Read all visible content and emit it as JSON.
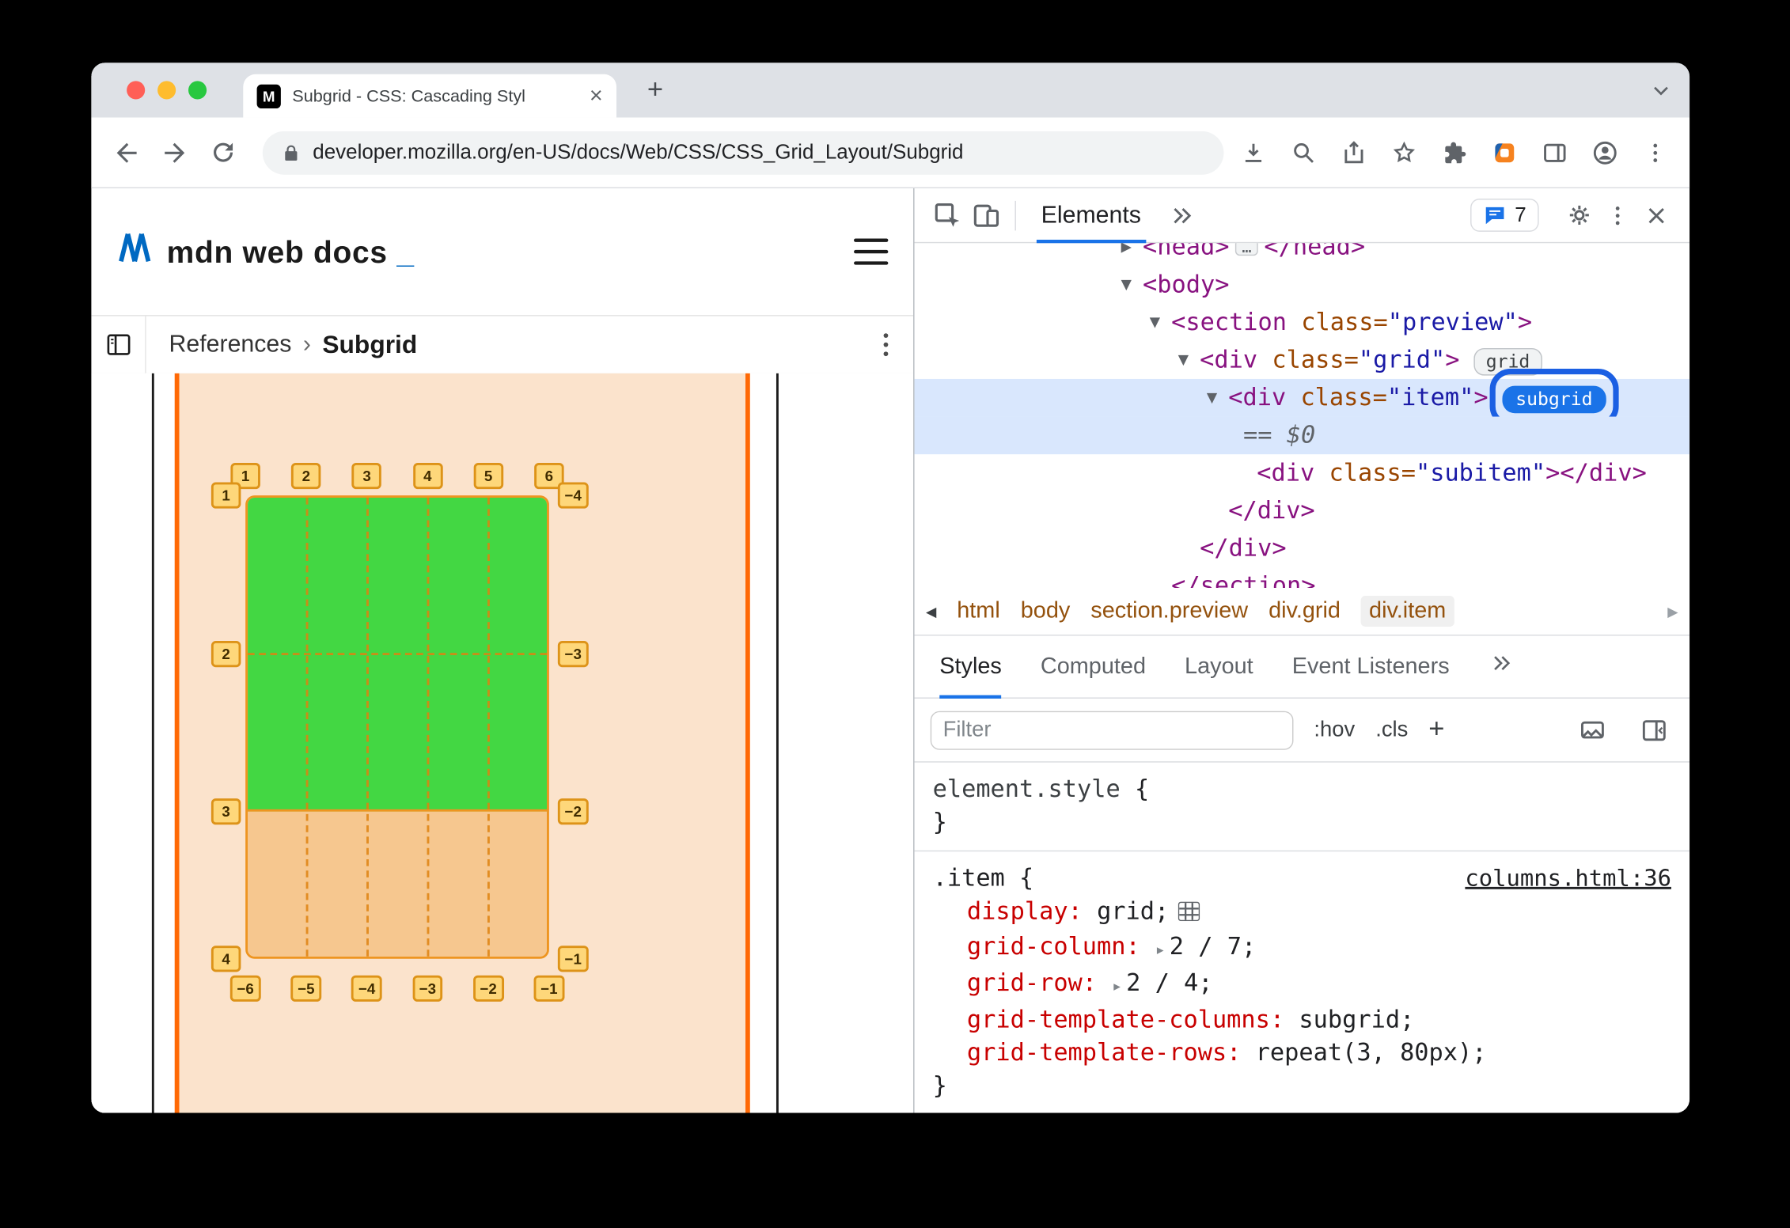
{
  "colors": {
    "accent_blue": "#1a73e8",
    "selection_blue": "#d9e7fd",
    "annotation_blue": "#1b5fe3",
    "grid_green": "#43d743",
    "grid_orange_line": "#ff6905",
    "grid_peach_fill": "#fbe3cc",
    "grid_item_fill": "#f6c78f",
    "badge_yellow": "#fed77a",
    "badge_border": "#dd9318",
    "tag_purple": "#881280",
    "attr_brown": "#994500",
    "value_blue": "#1a1aa6",
    "property_red": "#c80000",
    "crumb_brown": "#94520e",
    "traffic_red": "#ff5f57",
    "traffic_yellow": "#febc2e",
    "traffic_green": "#28c840",
    "mdn_blue": "#0069c2"
  },
  "browser": {
    "tab_title": "Subgrid - CSS: Cascading Styl",
    "tab_close_glyph": "×",
    "new_tab_label": "+",
    "url": "developer.mozilla.org/en-US/docs/Web/CSS/CSS_Grid_Layout/Subgrid"
  },
  "page": {
    "logo_text": "mdn web docs",
    "logo_underscore": "_",
    "breadcrumb_parent": "References",
    "breadcrumb_separator": "›",
    "breadcrumb_current": "Subgrid",
    "grid_figure": {
      "top_labels": [
        "1",
        "2",
        "3",
        "4",
        "5",
        "6"
      ],
      "left_labels": [
        "1",
        "2",
        "3",
        "4"
      ],
      "right_labels": [
        "−4",
        "−3",
        "−2",
        "−1"
      ],
      "bottom_labels": [
        "−6",
        "−5",
        "−4",
        "−3",
        "−2",
        "−1"
      ]
    }
  },
  "devtools": {
    "toolbar": {
      "elements_tab": "Elements",
      "console_count": "7"
    },
    "tree": [
      {
        "indent": 200,
        "arrow": "collapsed",
        "tokens": [
          [
            "tag",
            "<head>"
          ],
          [
            "more",
            "…"
          ],
          [
            "tag",
            "</head>"
          ]
        ]
      },
      {
        "indent": 200,
        "arrow": "expanded",
        "tokens": [
          [
            "tag",
            "<body>"
          ]
        ]
      },
      {
        "indent": 225,
        "arrow": "expanded",
        "tokens": [
          [
            "tag",
            "<section"
          ],
          [
            "attr",
            " class="
          ],
          [
            "val",
            "\"preview\""
          ],
          [
            "tag",
            ">"
          ]
        ]
      },
      {
        "indent": 250,
        "arrow": "expanded",
        "tokens": [
          [
            "tag",
            "<div"
          ],
          [
            "attr",
            " class="
          ],
          [
            "val",
            "\"grid\""
          ],
          [
            "tag",
            ">"
          ]
        ],
        "badge": "grid",
        "badge_style": "plain"
      },
      {
        "indent": 275,
        "arrow": "expanded",
        "highlight": true,
        "tokens": [
          [
            "tag",
            "<div"
          ],
          [
            "attr",
            " class="
          ],
          [
            "val",
            "\"item\""
          ],
          [
            "tag",
            ">"
          ]
        ],
        "badge": "subgrid",
        "badge_style": "active",
        "annotated": true
      },
      {
        "indent": 288,
        "highlight": true,
        "tokens": [
          [
            "flag",
            "== "
          ],
          [
            "flagval",
            "$0"
          ]
        ]
      },
      {
        "indent": 300,
        "tokens": [
          [
            "tag",
            "<div"
          ],
          [
            "attr",
            " class="
          ],
          [
            "val",
            "\"subitem\""
          ],
          [
            "tag",
            ">"
          ],
          [
            "tag",
            "</div>"
          ]
        ]
      },
      {
        "indent": 275,
        "tokens": [
          [
            "tag",
            "</div>"
          ]
        ]
      },
      {
        "indent": 250,
        "tokens": [
          [
            "tag",
            "</div>"
          ]
        ]
      },
      {
        "indent": 225,
        "tokens": [
          [
            "tag",
            "</section>"
          ]
        ]
      }
    ],
    "crumbs": {
      "items": [
        "html",
        "body",
        "section.preview",
        "div.grid",
        "div.item"
      ],
      "selected_index": 4
    },
    "sidebar_tabs": {
      "items": [
        "Styles",
        "Computed",
        "Layout",
        "Event Listeners"
      ],
      "selected_index": 0
    },
    "filter": {
      "placeholder": "Filter",
      "pseudo_toggle": ":hov",
      "class_toggle": ".cls",
      "new_rule": "+"
    },
    "styles": {
      "rules": [
        {
          "selector": "element.style",
          "open": "{",
          "close": "}",
          "source": "",
          "properties": []
        },
        {
          "selector": ".item",
          "open": "{",
          "close": "}",
          "source": "columns.html:36",
          "properties": [
            {
              "name": "display",
              "value": "grid;",
              "grid_editor": true
            },
            {
              "name": "grid-column",
              "value": "2 / 7;",
              "expandable": true
            },
            {
              "name": "grid-row",
              "value": "2 / 4;",
              "expandable": true
            },
            {
              "name": "grid-template-columns",
              "value": "subgrid;"
            },
            {
              "name": "grid-template-rows",
              "value": "repeat(3, 80px);"
            }
          ]
        }
      ]
    }
  }
}
